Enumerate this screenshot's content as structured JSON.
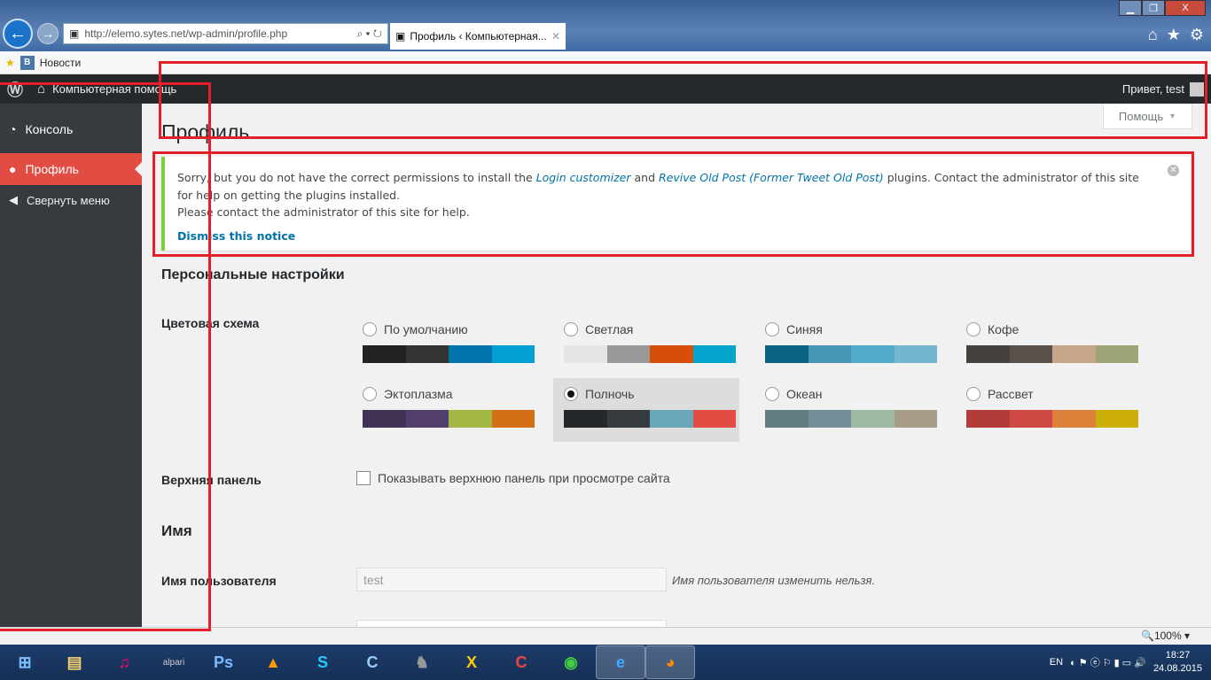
{
  "browser": {
    "url": "http://elemo.sytes.net/wp-admin/profile.php",
    "tab_title": "Профиль ‹ Компьютерная...",
    "favorites": [
      {
        "label": "Новости",
        "icon": "vk-icon"
      }
    ],
    "window_buttons": [
      "minimize",
      "restore",
      "close"
    ],
    "zoom": "100%"
  },
  "adminbar": {
    "site_name": "Компьютерная помощь",
    "greeting": "Привет, test"
  },
  "sidebar": {
    "items": [
      {
        "label": "Консоль",
        "icon": "dashboard-icon",
        "active": false
      },
      {
        "label": "Профиль",
        "icon": "user-icon",
        "active": true
      },
      {
        "label": "Свернуть меню",
        "icon": "collapse-icon",
        "active": false
      }
    ]
  },
  "help_label": "Помощь",
  "page_title": "Профиль",
  "notice": {
    "text1": "Sorry, but you do not have the correct permissions to install the",
    "link1": "Login customizer",
    "and": "and",
    "link2": "Revive Old Post (Former Tweet Old Post)",
    "text2": "plugins. Contact the administrator of this site for help on getting the plugins installed.",
    "text3": "Please contact the administrator of this site for help.",
    "dismiss": "Dismiss this notice",
    "accent": "#7ad03a"
  },
  "personal": {
    "heading": "Персональные настройки",
    "color_scheme_label": "Цветовая схема",
    "schemes": [
      {
        "name": "По умолчанию",
        "colors": [
          "#222222",
          "#333333",
          "#0073aa",
          "#00a0d2"
        ],
        "selected": false
      },
      {
        "name": "Светлая",
        "colors": [
          "#e5e5e5",
          "#999999",
          "#d64e07",
          "#04a4cc"
        ],
        "selected": false
      },
      {
        "name": "Синяя",
        "colors": [
          "#096484",
          "#4796b3",
          "#52accc",
          "#74b6ce"
        ],
        "selected": false
      },
      {
        "name": "Кофе",
        "colors": [
          "#46403c",
          "#59524c",
          "#c7a589",
          "#9ea476"
        ],
        "selected": false
      },
      {
        "name": "Эктоплазма",
        "colors": [
          "#413256",
          "#523f6d",
          "#a3b745",
          "#d46f15"
        ],
        "selected": false
      },
      {
        "name": "Полночь",
        "colors": [
          "#25282b",
          "#363b3f",
          "#69a8bb",
          "#e14d43"
        ],
        "selected": true
      },
      {
        "name": "Океан",
        "colors": [
          "#627c83",
          "#738e96",
          "#9ebaa0",
          "#aa9d88"
        ],
        "selected": false
      },
      {
        "name": "Рассвет",
        "colors": [
          "#b43c38",
          "#cf4944",
          "#dd823b",
          "#ccaf0b"
        ],
        "selected": false
      }
    ],
    "toolbar_label": "Верхняя панель",
    "toolbar_checkbox": "Показывать верхнюю панель при просмотре сайта",
    "toolbar_checked": false
  },
  "name_section": {
    "heading": "Имя",
    "username_label": "Имя пользователя",
    "username_value": "test",
    "username_hint": "Имя пользователя изменить нельзя."
  },
  "taskbar": {
    "apps": [
      "start",
      "explorer",
      "itunes",
      "alpari",
      "photoshop",
      "aimp",
      "skype",
      "app-c",
      "app-bird",
      "app-x",
      "ccleaner",
      "chrome",
      "internet-explorer",
      "firefox"
    ],
    "alpari_label": "alpari",
    "lang": "EN",
    "time": "18:27",
    "date": "24.08.2015"
  }
}
